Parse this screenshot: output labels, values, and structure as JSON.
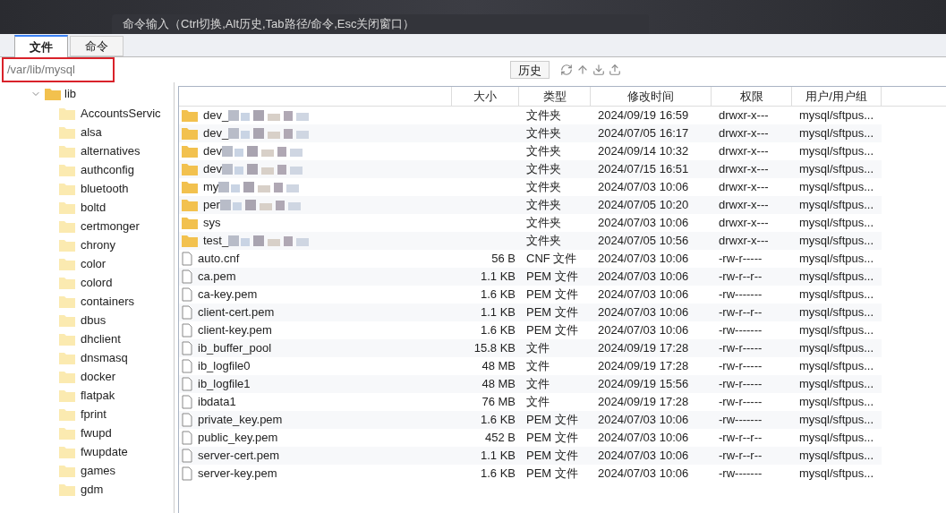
{
  "command_bar": {
    "hint": "命令输入（Ctrl切换,Alt历史,Tab路径/命令,Esc关闭窗口）"
  },
  "tabs": [
    {
      "label": "文件",
      "selected": true
    },
    {
      "label": "命令",
      "selected": false
    }
  ],
  "path_field": {
    "value": "/var/lib/mysql"
  },
  "toolbar": {
    "history_button": "历史"
  },
  "tree": {
    "label": "lib",
    "expanded": true,
    "children": [
      {
        "label": "AccountsServic"
      },
      {
        "label": "alsa"
      },
      {
        "label": "alternatives"
      },
      {
        "label": "authconfig"
      },
      {
        "label": "bluetooth"
      },
      {
        "label": "boltd"
      },
      {
        "label": "certmonger"
      },
      {
        "label": "chrony"
      },
      {
        "label": "color"
      },
      {
        "label": "colord"
      },
      {
        "label": "containers"
      },
      {
        "label": "dbus"
      },
      {
        "label": "dhclient"
      },
      {
        "label": "dnsmasq"
      },
      {
        "label": "docker"
      },
      {
        "label": "flatpak"
      },
      {
        "label": "fprint"
      },
      {
        "label": "fwupd"
      },
      {
        "label": "fwupdate"
      },
      {
        "label": "games"
      },
      {
        "label": "gdm"
      }
    ]
  },
  "table": {
    "columns": [
      "大小",
      "类型",
      "修改时间",
      "权限",
      "用户/用户组"
    ],
    "rows": [
      {
        "kind": "folder",
        "name": "dev_",
        "redacted": true,
        "size": "",
        "type": "文件夹",
        "modified": "2024/09/19 16:59",
        "perm": "drwxr-x---",
        "owner": "mysql/sftpus..."
      },
      {
        "kind": "folder",
        "name": "dev_",
        "redacted": true,
        "size": "",
        "type": "文件夹",
        "modified": "2024/07/05 16:17",
        "perm": "drwxr-x---",
        "owner": "mysql/sftpus..."
      },
      {
        "kind": "folder",
        "name": "dev",
        "redacted": true,
        "size": "",
        "type": "文件夹",
        "modified": "2024/09/14 10:32",
        "perm": "drwxr-x---",
        "owner": "mysql/sftpus..."
      },
      {
        "kind": "folder",
        "name": "dev",
        "redacted": true,
        "size": "",
        "type": "文件夹",
        "modified": "2024/07/15 16:51",
        "perm": "drwxr-x---",
        "owner": "mysql/sftpus..."
      },
      {
        "kind": "folder",
        "name": "my",
        "redacted": true,
        "size": "",
        "type": "文件夹",
        "modified": "2024/07/03 10:06",
        "perm": "drwxr-x---",
        "owner": "mysql/sftpus..."
      },
      {
        "kind": "folder",
        "name": "per",
        "redacted": true,
        "size": "",
        "type": "文件夹",
        "modified": "2024/07/05 10:20",
        "perm": "drwxr-x---",
        "owner": "mysql/sftpus..."
      },
      {
        "kind": "folder",
        "name": "sys",
        "redacted": false,
        "size": "",
        "type": "文件夹",
        "modified": "2024/07/03 10:06",
        "perm": "drwxr-x---",
        "owner": "mysql/sftpus..."
      },
      {
        "kind": "folder",
        "name": "test_",
        "redacted": true,
        "size": "",
        "type": "文件夹",
        "modified": "2024/07/05 10:56",
        "perm": "drwxr-x---",
        "owner": "mysql/sftpus..."
      },
      {
        "kind": "file",
        "name": "auto.cnf",
        "redacted": false,
        "size": "56 B",
        "type": "CNF 文件",
        "modified": "2024/07/03 10:06",
        "perm": "-rw-r-----",
        "owner": "mysql/sftpus..."
      },
      {
        "kind": "file",
        "name": "ca.pem",
        "redacted": false,
        "size": "1.1 KB",
        "type": "PEM 文件",
        "modified": "2024/07/03 10:06",
        "perm": "-rw-r--r--",
        "owner": "mysql/sftpus..."
      },
      {
        "kind": "file",
        "name": "ca-key.pem",
        "redacted": false,
        "size": "1.6 KB",
        "type": "PEM 文件",
        "modified": "2024/07/03 10:06",
        "perm": "-rw-------",
        "owner": "mysql/sftpus..."
      },
      {
        "kind": "file",
        "name": "client-cert.pem",
        "redacted": false,
        "size": "1.1 KB",
        "type": "PEM 文件",
        "modified": "2024/07/03 10:06",
        "perm": "-rw-r--r--",
        "owner": "mysql/sftpus..."
      },
      {
        "kind": "file",
        "name": "client-key.pem",
        "redacted": false,
        "size": "1.6 KB",
        "type": "PEM 文件",
        "modified": "2024/07/03 10:06",
        "perm": "-rw-------",
        "owner": "mysql/sftpus..."
      },
      {
        "kind": "file",
        "name": "ib_buffer_pool",
        "redacted": false,
        "size": "15.8 KB",
        "type": "文件",
        "modified": "2024/09/19 17:28",
        "perm": "-rw-r-----",
        "owner": "mysql/sftpus..."
      },
      {
        "kind": "file",
        "name": "ib_logfile0",
        "redacted": false,
        "size": "48 MB",
        "type": "文件",
        "modified": "2024/09/19 17:28",
        "perm": "-rw-r-----",
        "owner": "mysql/sftpus..."
      },
      {
        "kind": "file",
        "name": "ib_logfile1",
        "redacted": false,
        "size": "48 MB",
        "type": "文件",
        "modified": "2024/09/19 15:56",
        "perm": "-rw-r-----",
        "owner": "mysql/sftpus..."
      },
      {
        "kind": "file",
        "name": "ibdata1",
        "redacted": false,
        "size": "76 MB",
        "type": "文件",
        "modified": "2024/09/19 17:28",
        "perm": "-rw-r-----",
        "owner": "mysql/sftpus..."
      },
      {
        "kind": "file",
        "name": "private_key.pem",
        "redacted": false,
        "size": "1.6 KB",
        "type": "PEM 文件",
        "modified": "2024/07/03 10:06",
        "perm": "-rw-------",
        "owner": "mysql/sftpus..."
      },
      {
        "kind": "file",
        "name": "public_key.pem",
        "redacted": false,
        "size": "452 B",
        "type": "PEM 文件",
        "modified": "2024/07/03 10:06",
        "perm": "-rw-r--r--",
        "owner": "mysql/sftpus..."
      },
      {
        "kind": "file",
        "name": "server-cert.pem",
        "redacted": false,
        "size": "1.1 KB",
        "type": "PEM 文件",
        "modified": "2024/07/03 10:06",
        "perm": "-rw-r--r--",
        "owner": "mysql/sftpus..."
      },
      {
        "kind": "file",
        "name": "server-key.pem",
        "redacted": false,
        "size": "1.6 KB",
        "type": "PEM 文件",
        "modified": "2024/07/03 10:06",
        "perm": "-rw-------",
        "owner": "mysql/sftpus..."
      }
    ]
  }
}
